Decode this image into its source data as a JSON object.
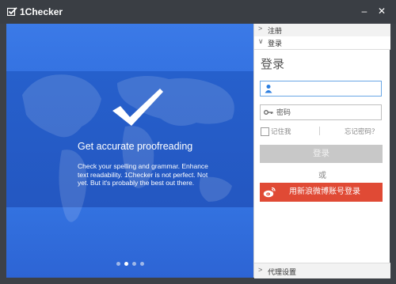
{
  "window": {
    "title": "1Checker",
    "minimize_glyph": "–",
    "close_glyph": "✕"
  },
  "hero": {
    "headline": "Get accurate proofreading",
    "description": "Check your spelling and grammar. Enhance text readability. 1Checker is not perfect. Not yet. But it's probably the best out there.",
    "carousel_dots": 4,
    "active_dot": 1
  },
  "side": {
    "register_header": "注册",
    "login_header": "登录",
    "proxy_header": "代理设置",
    "login_title": "登录",
    "username_placeholder": "",
    "password_placeholder": "密码",
    "remember_label": "记住我",
    "forgot_label": "忘记密码？",
    "login_button": "登录",
    "or_text": "或",
    "weibo_button": "用新浪微博账号登录"
  },
  "colors": {
    "titlebar": "#3a3e44",
    "hero_blue": "#2f69d9",
    "weibo_red": "#e04a35",
    "login_disabled": "#c8c8c8"
  }
}
